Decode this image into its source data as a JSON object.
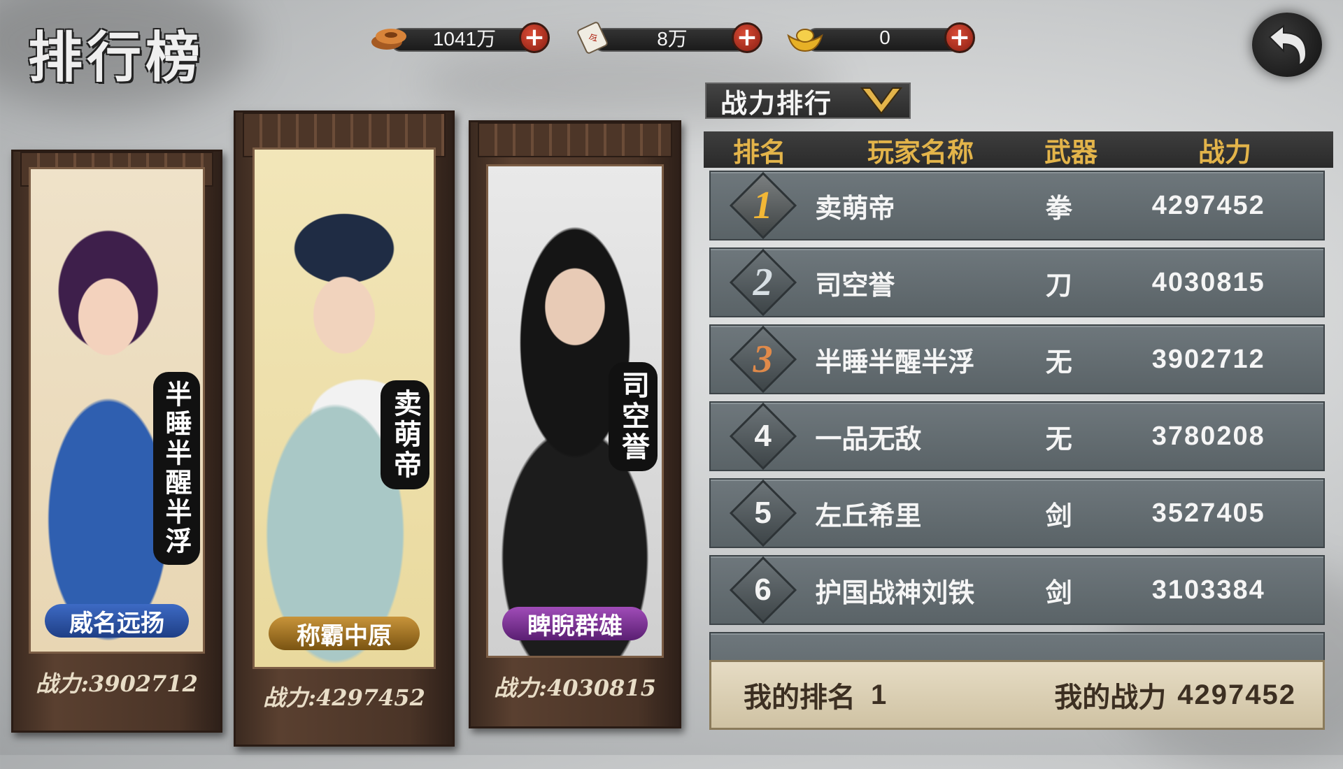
{
  "title": "排行榜",
  "currencies": [
    {
      "name": "coin-icon",
      "value": "1041万"
    },
    {
      "name": "token-icon",
      "value": "8万"
    },
    {
      "name": "gold-ingot-icon",
      "value": "0"
    }
  ],
  "dropdown": {
    "label": "战力排行"
  },
  "table": {
    "headers": [
      "排名",
      "玩家名称",
      "武器",
      "战力"
    ],
    "rows": [
      {
        "rank": "1",
        "name": "卖萌帝",
        "weapon": "拳",
        "power": "4297452"
      },
      {
        "rank": "2",
        "name": "司空誉",
        "weapon": "刀",
        "power": "4030815"
      },
      {
        "rank": "3",
        "name": "半睡半醒半浮",
        "weapon": "无",
        "power": "3902712"
      },
      {
        "rank": "4",
        "name": "一品无敌",
        "weapon": "无",
        "power": "3780208"
      },
      {
        "rank": "5",
        "name": "左丘希里",
        "weapon": "剑",
        "power": "3527405"
      },
      {
        "rank": "6",
        "name": "护国战神刘铁",
        "weapon": "剑",
        "power": "3103384"
      }
    ]
  },
  "my": {
    "rank_label": "我的排名",
    "rank": "1",
    "power_label": "我的战力",
    "power": "4297452"
  },
  "podium": {
    "first": {
      "name": "卖萌帝",
      "banner": "称霸中原",
      "power": "战力:4297452",
      "color": "#8a6a2a"
    },
    "second": {
      "name": "司空誉",
      "banner": "睥睨群雄",
      "power": "战力:4030815",
      "color": "#7a2f8a"
    },
    "third": {
      "name": "半睡半醒半浮",
      "banner": "威名远扬",
      "power": "战力:3902712",
      "color": "#2c4f9e"
    }
  }
}
